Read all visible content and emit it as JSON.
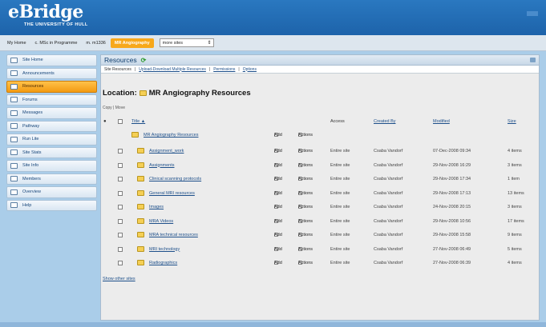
{
  "header": {
    "logo_e": "e",
    "logo_main": "Bridge",
    "logo_sub": "THE UNIVERSITY OF HULL"
  },
  "nav": {
    "tabs": [
      "My Home",
      "c. MSc in Programme",
      "m. m1336",
      "MR Angiography",
      "more sites"
    ],
    "active_index": 3
  },
  "sidebar": {
    "items": [
      {
        "label": "Site Home",
        "icon": "home-icon"
      },
      {
        "label": "Announcements",
        "icon": "megaphone-icon"
      },
      {
        "label": "Resources",
        "icon": "folder-icon"
      },
      {
        "label": "Forums",
        "icon": "forum-icon"
      },
      {
        "label": "Messages",
        "icon": "mail-icon"
      },
      {
        "label": "Pathway",
        "icon": "pathway-icon"
      },
      {
        "label": "Run Lite",
        "icon": "run-icon"
      },
      {
        "label": "Site Stats",
        "icon": "stats-icon"
      },
      {
        "label": "Site Info",
        "icon": "info-icon"
      },
      {
        "label": "Members",
        "icon": "members-icon"
      },
      {
        "label": "Overview",
        "icon": "overview-icon"
      },
      {
        "label": "Help",
        "icon": "help-icon"
      }
    ],
    "active_index": 2
  },
  "main": {
    "title": "Resources",
    "toolbar": {
      "items": [
        "Site Resources",
        "Upload-Download Multiple Resources",
        "Permissions",
        "Options"
      ]
    },
    "location_label": "Location:",
    "location_name": "MR Angiography Resources",
    "view_line": "Copy | Move",
    "columns": {
      "title": "Title ▲",
      "access": "Access",
      "created_by": "Created By",
      "modified": "Modified",
      "size": "Size"
    },
    "root": {
      "title": "MR Angiography Resources",
      "add": "Add",
      "actions": "Actions"
    },
    "rows": [
      {
        "title": "Assignment_work",
        "add": "Add",
        "actions": "Actions",
        "access": "Entire site",
        "created_by": "Csaba Vandorf",
        "modified": "07-Dec-2008 09:34",
        "size": "4 items"
      },
      {
        "title": "Assignments",
        "add": "Add",
        "actions": "Actions",
        "access": "Entire site",
        "created_by": "Csaba Vandorf",
        "modified": "29-Nov-2008 16:29",
        "size": "3 items"
      },
      {
        "title": "Clinical scanning protocols",
        "add": "Add",
        "actions": "Actions",
        "access": "Entire site",
        "created_by": "Csaba Vandorf",
        "modified": "29-Nov-2008 17:34",
        "size": "1 item"
      },
      {
        "title": "General MRI resources",
        "add": "Add",
        "actions": "Actions",
        "access": "Entire site",
        "created_by": "Csaba Vandorf",
        "modified": "29-Nov-2008 17:13",
        "size": "13 items"
      },
      {
        "title": "Images",
        "add": "Add",
        "actions": "Actions",
        "access": "Entire site",
        "created_by": "Csaba Vandorf",
        "modified": "24-Nov-2008 20:15",
        "size": "3 items"
      },
      {
        "title": "MRA Videos",
        "add": "Add",
        "actions": "Actions",
        "access": "Entire site",
        "created_by": "Csaba Vandorf",
        "modified": "29-Nov-2008 10:56",
        "size": "17 items"
      },
      {
        "title": "MRA technical resources",
        "add": "Add",
        "actions": "Actions",
        "access": "Entire site",
        "created_by": "Csaba Vandorf",
        "modified": "29-Nov-2008 15:58",
        "size": "9 items"
      },
      {
        "title": "MRI technology",
        "add": "Add",
        "actions": "Actions",
        "access": "Entire site",
        "created_by": "Csaba Vandorf",
        "modified": "27-Nov-2008 06:49",
        "size": "5 items"
      },
      {
        "title": "Radiographics",
        "add": "Add",
        "actions": "Actions",
        "access": "Entire site",
        "created_by": "Csaba Vandorf",
        "modified": "27-Nov-2008 06:39",
        "size": "4 items"
      }
    ],
    "show_other": "Show other sites"
  },
  "colors": {
    "header": "#1d63aa",
    "active_tab": "#f7a81b",
    "link": "#1d4f8a",
    "page_bg": "#aacde9"
  }
}
